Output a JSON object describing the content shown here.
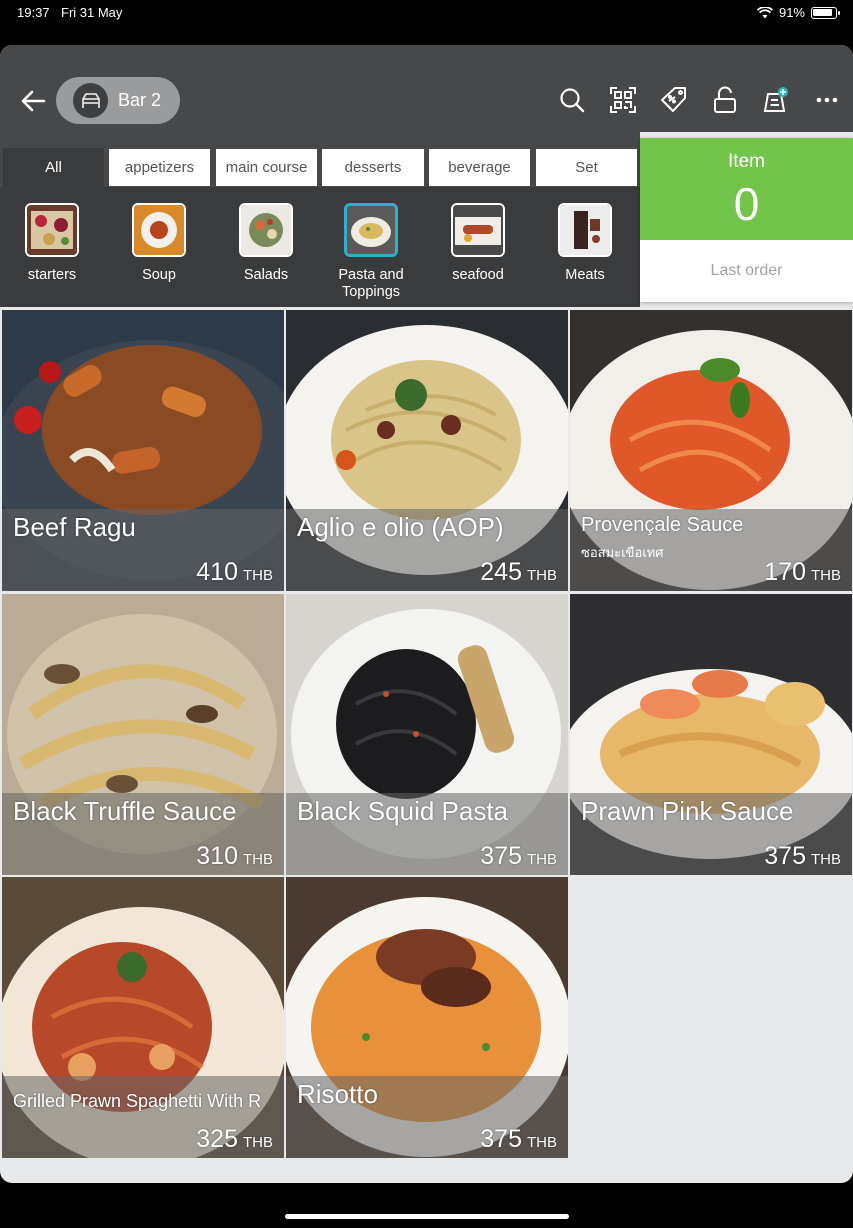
{
  "status": {
    "time": "19:37",
    "date": "Fri 31 May",
    "battery": "91%"
  },
  "header": {
    "table_name": "Bar 2"
  },
  "tabs": [
    "All",
    "appetizers",
    "main course",
    "desserts",
    "beverage",
    "Set"
  ],
  "subcategories": [
    "starters",
    "Soup",
    "Salads",
    "Pasta and Toppings",
    "seafood",
    "Meats"
  ],
  "order_panel": {
    "label": "Item",
    "count": "0",
    "last_order": "Last order"
  },
  "currency": "THB",
  "menu_items": [
    {
      "name": "Beef Ragu",
      "subtitle": "",
      "price": "410"
    },
    {
      "name": "Aglio e olio (AOP)",
      "subtitle": "",
      "price": "245"
    },
    {
      "name": "Provençale Sauce",
      "subtitle": "ซอสมะเขือเทศ",
      "price": "170"
    },
    {
      "name": "Black Truffle Sauce",
      "subtitle": "",
      "price": "310"
    },
    {
      "name": "Black Squid Pasta",
      "subtitle": "",
      "price": "375"
    },
    {
      "name": "Prawn Pink Sauce",
      "subtitle": "",
      "price": "375"
    },
    {
      "name": "Grilled Prawn Spaghetti With R",
      "subtitle": "",
      "price": "325"
    },
    {
      "name": "Risotto",
      "subtitle": "",
      "price": "375"
    }
  ],
  "colors": {
    "header": "#474849",
    "accent_green": "#72c44b",
    "selected_border": "#2cb2c7"
  }
}
